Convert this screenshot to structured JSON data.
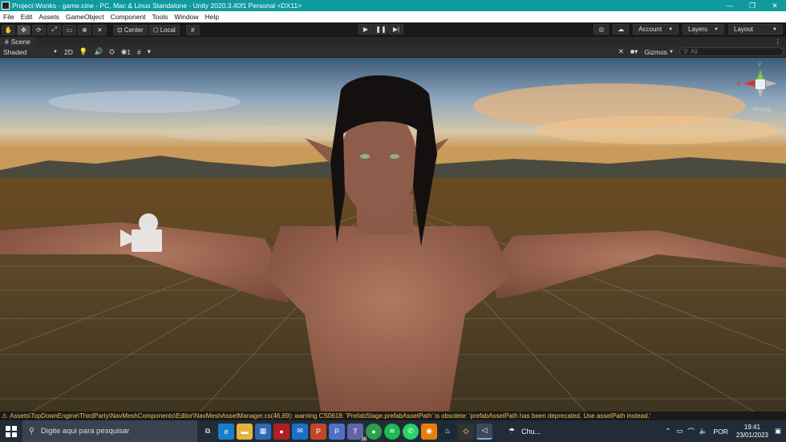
{
  "window": {
    "title": "Project-Wonks - game.cine - PC, Mac & Linux Standalone - Unity 2020.3.40f1 Personal <DX11>",
    "controls": [
      "—",
      "❐",
      "✕"
    ]
  },
  "menu": [
    "File",
    "Edit",
    "Assets",
    "GameObject",
    "Component",
    "Tools",
    "Window",
    "Help"
  ],
  "toolbar": {
    "center_label": "Center",
    "local_label": "Local",
    "account_label": "Account",
    "layers_label": "Layers",
    "layout_label": "Layout"
  },
  "scene": {
    "tab_label": "Scene",
    "shading_mode": "Shaded",
    "mode_2d": "2D",
    "hidden_count": "1",
    "gizmos_label": "Gizmos",
    "search_placeholder": "All",
    "persp_label": "<Persp",
    "axis_y": "y",
    "axis_x": "x"
  },
  "console": {
    "message": "Assets\\TopDownEngine\\ThirdParty\\NavMeshComponents\\Editor\\NavMeshAssetManager.cs(46,69): warning CS0618: 'PrefabStage.prefabAssetPath' is obsolete: 'prefabAssetPath has been deprecated. Use assetPath instead.'"
  },
  "taskbar": {
    "search_placeholder": "Digite aqui para pesquisar",
    "teams_badge": "38",
    "weather_text": "Chu...",
    "language": "POR",
    "time": "19:41",
    "date": "23/01/2023"
  },
  "colors": {
    "titlebar": "#0f9a9e",
    "editor_bg": "#191919",
    "warning": "#f3c44a",
    "taskbar": "#222c36"
  }
}
